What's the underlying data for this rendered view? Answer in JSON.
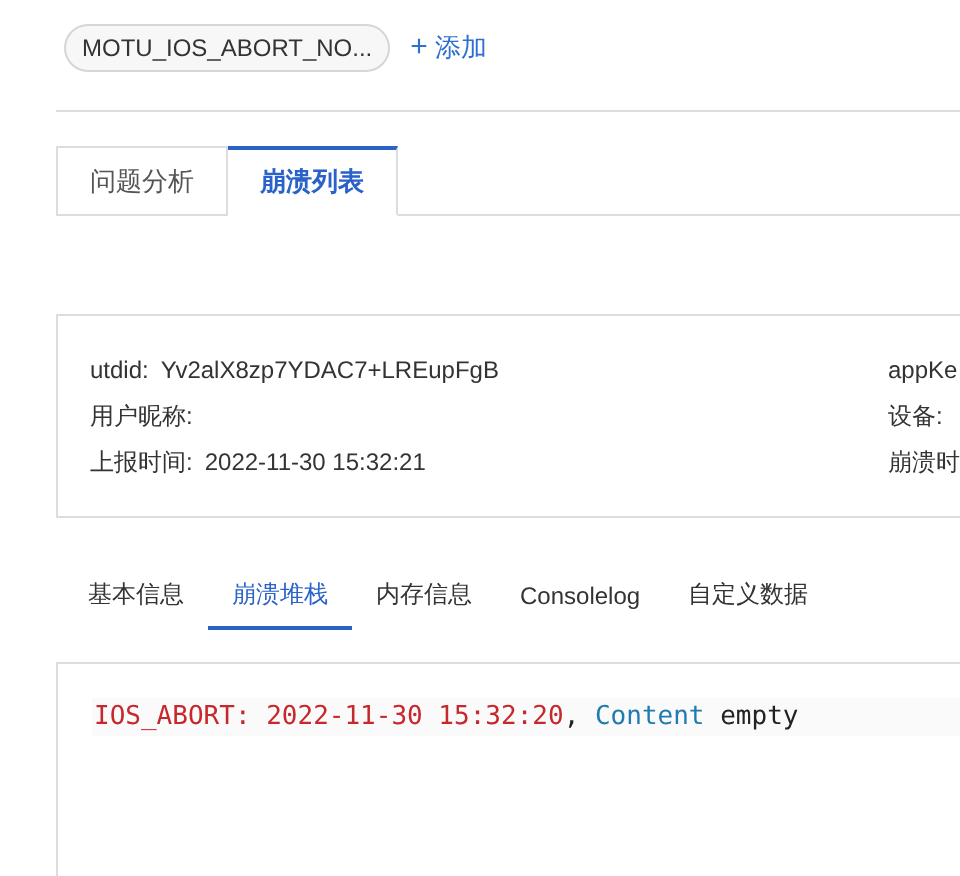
{
  "chip": {
    "label": "MOTU_IOS_ABORT_NO..."
  },
  "add_link": {
    "icon": "+",
    "label": "添加"
  },
  "tabs": [
    {
      "label": "问题分析",
      "selected": false
    },
    {
      "label": "崩溃列表",
      "selected": true
    }
  ],
  "info": {
    "left": [
      {
        "label": "utdid:",
        "value": "Yv2alX8zp7YDAC7+LREupFgB"
      },
      {
        "label": "用户昵称:"
      },
      {
        "label": "上报时间:",
        "value": "2022-11-30 15:32:21"
      }
    ],
    "right": [
      {
        "label": "appKe"
      },
      {
        "label": "设备:"
      },
      {
        "label": "崩溃时"
      }
    ]
  },
  "subtabs": [
    {
      "label": "基本信息",
      "selected": false
    },
    {
      "label": "崩溃堆栈",
      "selected": true
    },
    {
      "label": "内存信息",
      "selected": false
    },
    {
      "label": "Consolelog",
      "selected": false
    },
    {
      "label": "自定义数据",
      "selected": false
    }
  ],
  "code_line": [
    {
      "kind": "error",
      "text": "IOS_ABORT: 2022-11-30 15:32:20"
    },
    {
      "kind": "plain",
      "text": ", "
    },
    {
      "kind": "keyword",
      "text": "Content"
    },
    {
      "kind": "plain",
      "text": " empty"
    }
  ]
}
